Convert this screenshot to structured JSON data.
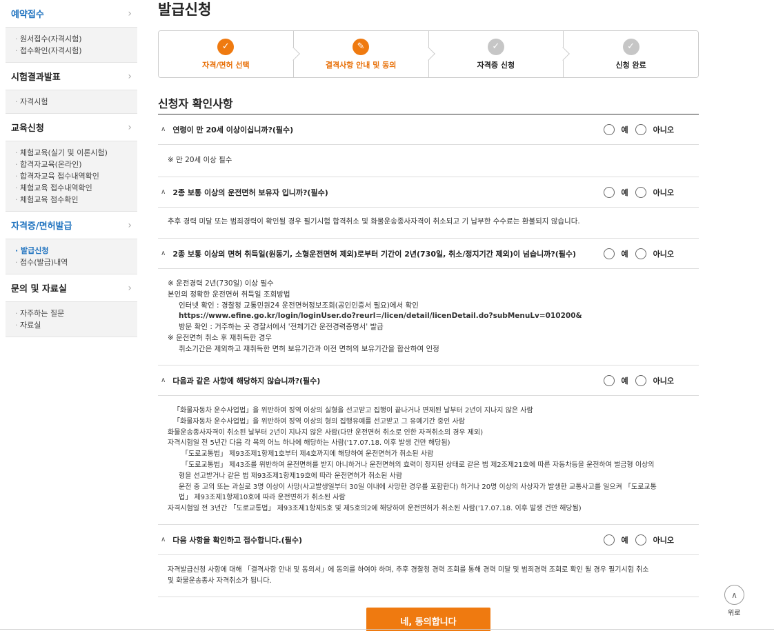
{
  "sidebar": {
    "sections": [
      {
        "title": "예약접수",
        "active": true,
        "items": [
          {
            "label": "원서접수(자격시험)"
          },
          {
            "label": "접수확인(자격시험)"
          }
        ]
      },
      {
        "title": "시험결과발표",
        "items": [
          {
            "label": "자격시험"
          }
        ]
      },
      {
        "title": "교육신청",
        "items": [
          {
            "label": "체험교육(실기 및 이론시험)"
          },
          {
            "label": "합격자교육(온라인)"
          },
          {
            "label": "합격자교육 접수내역확인"
          },
          {
            "label": "체험교육 접수내역확인"
          },
          {
            "label": "체험교육 점수확인"
          }
        ]
      },
      {
        "title": "자격증/면허발급",
        "active": true,
        "items": [
          {
            "label": "발급신청",
            "selected": true
          },
          {
            "label": "접수(발급)내역"
          }
        ]
      },
      {
        "title": "문의 및 자료실",
        "items": [
          {
            "label": "자주하는 질문"
          },
          {
            "label": "자료실"
          }
        ]
      }
    ]
  },
  "page_title": "발급신청",
  "steps": [
    {
      "label": "자격/면허 선택",
      "state": "done",
      "icon": "check-icon"
    },
    {
      "label": "결격사항 안내 및 동의",
      "state": "current",
      "icon": "pencil-icon"
    },
    {
      "label": "자격증 신청",
      "state": "todo",
      "icon": "check-icon"
    },
    {
      "label": "신청 완료",
      "state": "todo",
      "icon": "check-icon"
    }
  ],
  "section_title": "신청자 확인사항",
  "radio_yes": "예",
  "radio_no": "아니오",
  "questions": [
    {
      "text": "연령이 만 20세 이상이십니까?(필수)",
      "note": [
        "※ 만 20세 이상 필수"
      ]
    },
    {
      "text": "2종 보통 이상의 운전면허 보유자 입니까?(필수)",
      "note": [
        "추후 경력 미달 또는 범죄경력이 확인될 경우 필기시험 합격취소 및 화물운송종사자격이 취소되고 기 납부한 수수료는 환불되지 않습니다."
      ]
    },
    {
      "text": "2종 보통 이상의 면허 취득일(원동기, 소형운전면허 제외)로부터 기간이 2년(730일, 취소/정지기간 제외)이 넘습니까?(필수)",
      "note": [
        "※ 운전경력 2년(730일) 이상 필수",
        "본인의 정확한 운전면허 취득일 조회방법",
        "인터넷 확인 : 경찰청 교통민원24 운전면허정보조회(공인인증서 필요)에서 확인",
        "https://www.efine.go.kr/login/loginUser.do?reurl=/licen/detail/licenDetail.do?subMenuLv=010200&",
        "방문 확인 : 거주하는 곳 경찰서에서 '전체기간 운전경력증명서' 발급",
        "※ 운전면허 취소 후 재취득한 경우",
        "취소기간은 제외하고 재취득한 면허 보유기간과 이전 면허의 보유기간을 합산하여 인정"
      ]
    },
    {
      "text": "다음과 같은 사항에 해당하지 않습니까?(필수)",
      "note": [
        "「화물자동차 운수사업법」을 위반하여 징역 이상의 실형을 선고받고 집행이 끝나거나 면제된 날부터 2년이 지나지 않은 사람",
        "「화물자동차 운수사업법」을 위반하여 징역 이상의 형의 집행유예를 선고받고 그 유예기간 중인 사람",
        "화물운송종사자격이 취소된 날부터 2년이 지나지 않은 사람(다만 운전면허 취소로 인한 자격취소의 경우 제외)",
        "자격시험일 전 5년간 다음 각 목의 어느 하나에 해당하는 사람('17.07.18. 이후 발생 건만 해당됨)",
        "「도로교통법」 제93조제1항제1호부터 제4호까지에 해당하여 운전면허가 취소된 사람",
        "「도로교통법」 제43조를 위반하여 운전면허를 받지 아니하거나 운전면허의 효력이 정지된 상태로 같은 법 제2조제21호에 따른 자동차등을 운전하여 벌금형 이상의",
        "형을 선고받거나 같은 법 제93조제1항제19호에 따라 운전면허가 취소된 사람",
        "운전 중 고의 또는 과실로 3명 이상이 사망(사고발생일부터 30일 이내에 사망한 경우를 포함한다) 하거나 20명 이상의 사상자가 발생한 교통사고를 일으켜 「도로교통",
        "법」 제93조제1항제10호에 따라 운전면허가 취소된 사람",
        "자격시험일 전 3년간 「도로교통법」 제93조제1항제5호 및 제5호의2에 해당하여 운전면허가 취소된 사람('17.07.18. 이후 발생 건만 해당됨)"
      ]
    },
    {
      "text": "다음 사항을 확인하고 접수합니다.(필수)",
      "note": [
        "자격발급신청 사항에 대해 「결격사항 안내 및 동의서」에 동의를 하여야 하며, 추후 경찰청 경력 조회를 통해 경력 미달 및 범죄경력 조회로 확인 될 경우 필기시험 취소",
        "및 화물운송종사 자격취소가 됩니다."
      ]
    }
  ],
  "agree_button": "네, 동의합니다",
  "top_button": "위로"
}
